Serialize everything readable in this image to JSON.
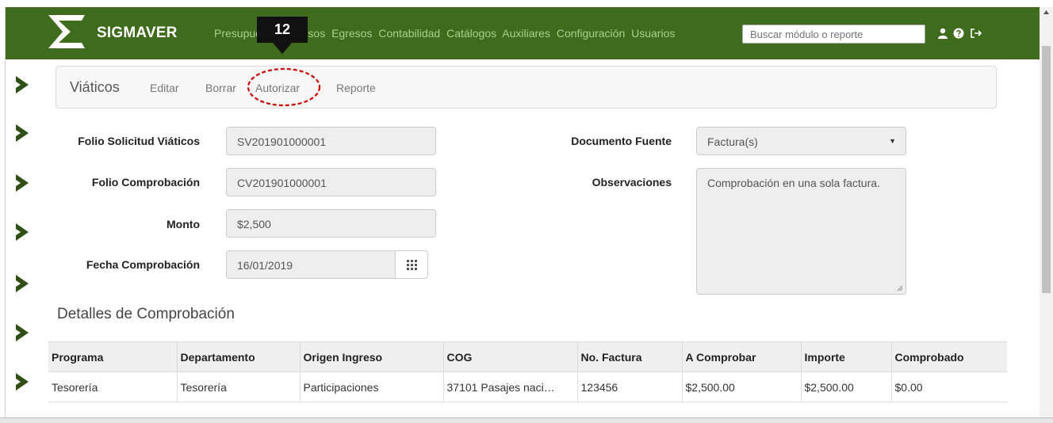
{
  "brand": {
    "name": "SIGMAVER"
  },
  "nav": {
    "items": [
      "Presupuesto",
      "Ingresos",
      "Egresos",
      "Contabilidad",
      "Catálogos",
      "Auxiliares",
      "Configuración",
      "Usuarios"
    ],
    "search_placeholder": "Buscar módulo o reporte",
    "icons": [
      "user-icon",
      "help-icon",
      "logout-icon"
    ]
  },
  "callout": {
    "number": "12"
  },
  "subbar": {
    "title": "Viáticos",
    "links": {
      "edit": "Editar",
      "delete": "Borrar",
      "authorize": "Autorizar",
      "report": "Reporte"
    }
  },
  "form": {
    "folio_solicitud": {
      "label": "Folio Solicitud Viáticos",
      "value": "SV201901000001"
    },
    "folio_comprobacion": {
      "label": "Folio Comprobación",
      "value": "CV201901000001"
    },
    "monto": {
      "label": "Monto",
      "value": "$2,500"
    },
    "fecha": {
      "label": "Fecha Comprobación",
      "value": "16/01/2019"
    },
    "documento_fuente": {
      "label": "Documento Fuente",
      "value": "Factura(s)"
    },
    "observaciones": {
      "label": "Observaciones",
      "value": "Comprobación en una sola factura."
    }
  },
  "details": {
    "title": "Detalles de Comprobación",
    "headers": [
      "Programa",
      "Departamento",
      "Origen Ingreso",
      "COG",
      "No. Factura",
      "A Comprobar",
      "Importe",
      "Comprobado"
    ],
    "rows": [
      [
        "Tesorería",
        "Tesorería",
        "Participaciones",
        "37101 Pasajes naci…",
        "123456",
        "$2,500.00",
        "$2,500.00",
        "$0.00"
      ]
    ]
  },
  "colors": {
    "navbar": "#3e6b1c",
    "nav_link": "#a9d08e",
    "sidebar_arrow": "#2f4f17",
    "callout_ring": "#cc0000"
  }
}
